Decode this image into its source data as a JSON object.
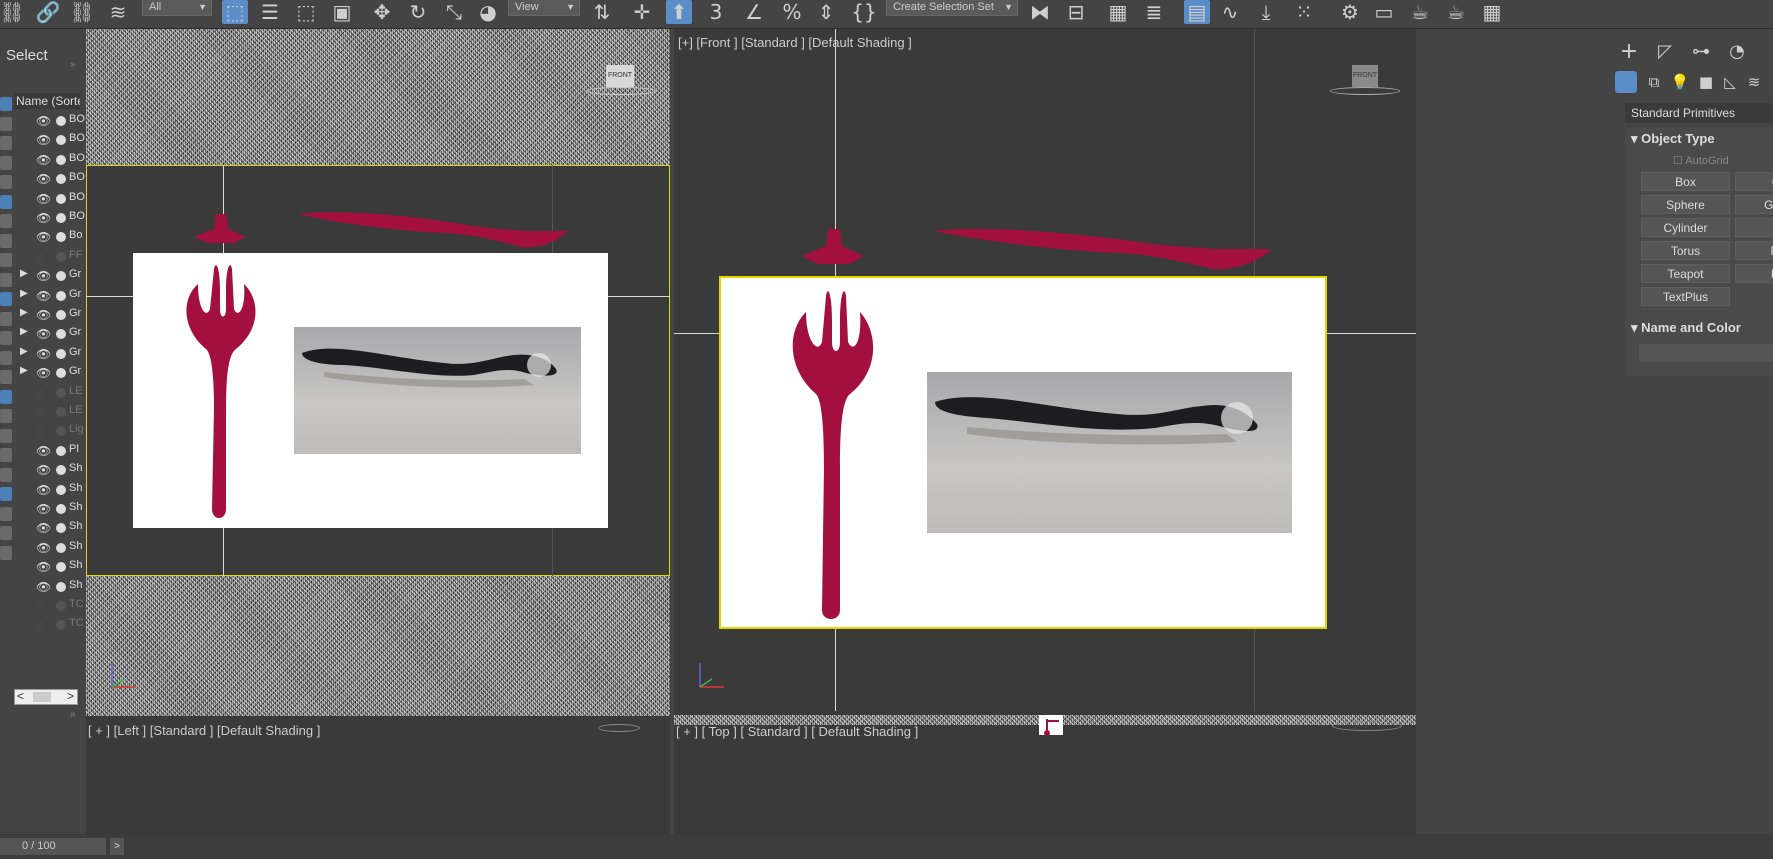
{
  "toolbar": {
    "filter_dropdown": "All",
    "refcoord_dropdown": "View",
    "selection_set": "Create Selection Set"
  },
  "explorer": {
    "title": "Select",
    "column_header": "Name (Sorte",
    "rows": [
      {
        "label": "BO",
        "visible": true,
        "dim": false,
        "expand": false
      },
      {
        "label": "BO",
        "visible": true,
        "dim": false,
        "expand": false
      },
      {
        "label": "BO",
        "visible": true,
        "dim": false,
        "expand": false
      },
      {
        "label": "BO",
        "visible": true,
        "dim": false,
        "expand": false
      },
      {
        "label": "BO",
        "visible": true,
        "dim": false,
        "expand": false
      },
      {
        "label": "BO",
        "visible": true,
        "dim": false,
        "expand": false
      },
      {
        "label": "Bo",
        "visible": true,
        "dim": false,
        "expand": false
      },
      {
        "label": "FF",
        "visible": false,
        "dim": true,
        "expand": false
      },
      {
        "label": "Gr",
        "visible": true,
        "dim": false,
        "expand": true
      },
      {
        "label": "Gr",
        "visible": true,
        "dim": false,
        "expand": true
      },
      {
        "label": "Gr",
        "visible": true,
        "dim": false,
        "expand": true
      },
      {
        "label": "Gr",
        "visible": true,
        "dim": false,
        "expand": true
      },
      {
        "label": "Gr",
        "visible": true,
        "dim": false,
        "expand": true
      },
      {
        "label": "Gr",
        "visible": true,
        "dim": false,
        "expand": true
      },
      {
        "label": "LE",
        "visible": false,
        "dim": true,
        "expand": false
      },
      {
        "label": "LE",
        "visible": false,
        "dim": true,
        "expand": false
      },
      {
        "label": "Lig",
        "visible": false,
        "dim": true,
        "expand": false
      },
      {
        "label": "Pl",
        "visible": true,
        "dim": false,
        "expand": false
      },
      {
        "label": "Sh",
        "visible": true,
        "dim": false,
        "expand": false
      },
      {
        "label": "Sh",
        "visible": true,
        "dim": false,
        "expand": false
      },
      {
        "label": "Sh",
        "visible": true,
        "dim": false,
        "expand": false
      },
      {
        "label": "Sh",
        "visible": true,
        "dim": false,
        "expand": false
      },
      {
        "label": "Sh",
        "visible": true,
        "dim": false,
        "expand": false
      },
      {
        "label": "Sh",
        "visible": true,
        "dim": false,
        "expand": false
      },
      {
        "label": "Sh",
        "visible": true,
        "dim": false,
        "expand": false
      },
      {
        "label": "TC",
        "visible": false,
        "dim": true,
        "expand": false
      },
      {
        "label": "TC",
        "visible": false,
        "dim": true,
        "expand": false
      }
    ]
  },
  "viewports": {
    "front_label": "[+] [Front ] [Standard ] [Default Shading ]",
    "left_label": "[ + ] [Left ] [Standard ] [Default Shading ]",
    "top_label": "[ + ] [ Top ] [ Standard ] [ Default Shading ]",
    "viewcube_label": "FRONT"
  },
  "command_panel": {
    "category": "Standard Primitives",
    "object_type_title": "Object Type",
    "autogrid": "AutoGrid",
    "primitives": [
      "Box",
      "Co",
      "Sphere",
      "GeoS",
      "Cylinder",
      "Tu",
      "Torus",
      "Pyr",
      "Teapot",
      "Pla",
      "TextPlus"
    ],
    "name_and_color_title": "Name and Color"
  },
  "timeline": {
    "frame_counter": "0 / 100"
  },
  "colors": {
    "accent": "#5b8dc9",
    "mesh": "#a3103f",
    "selection": "#e2d600"
  }
}
